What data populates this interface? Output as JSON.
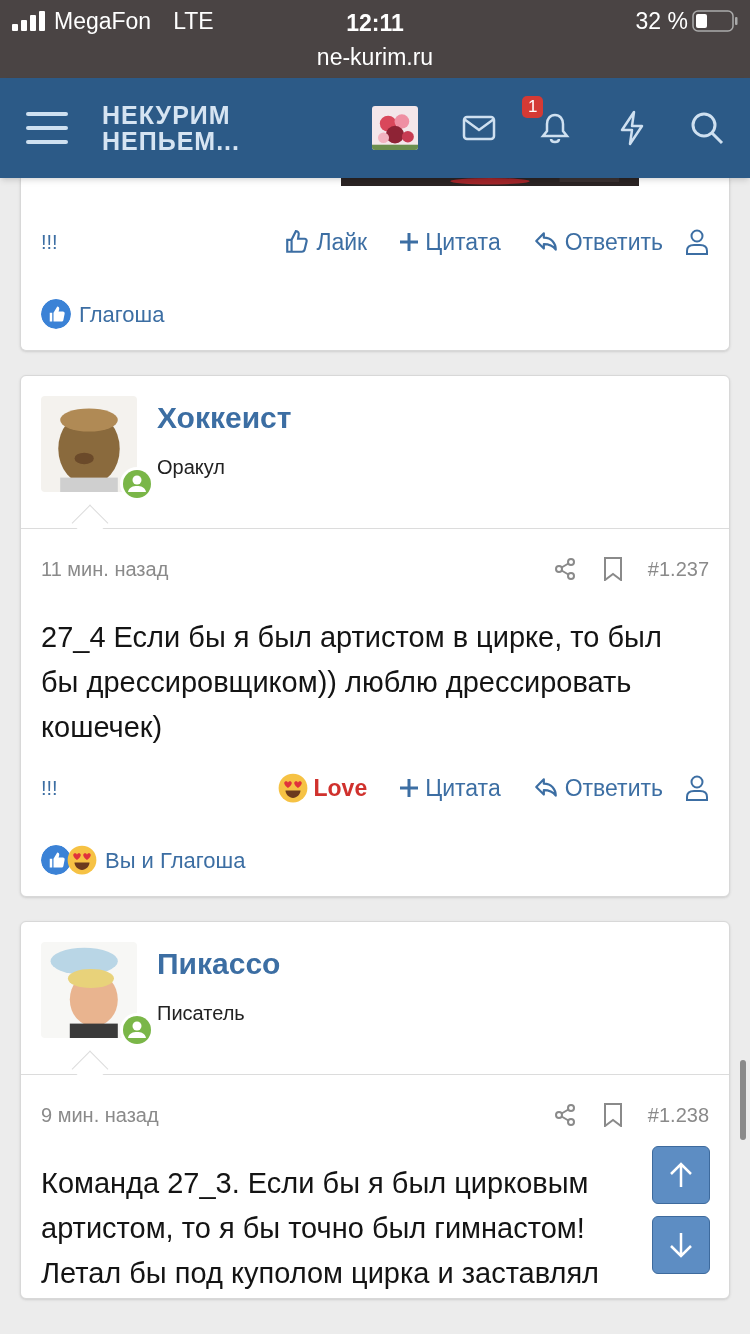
{
  "status_bar": {
    "carrier": "MegaFon",
    "network": "LTE",
    "time": "12:11",
    "url": "ne-kurim.ru",
    "battery": "32 %"
  },
  "header": {
    "logo_line1": "НЕКУРИМ",
    "logo_line2": "НЕПЬЕМ...",
    "notification_count": "1"
  },
  "posts": [
    {
      "flag": "!!!",
      "reaction_button": {
        "kind": "like",
        "label": "Лайк"
      },
      "quote": "Цитата",
      "reply": "Ответить",
      "reactions": {
        "icons": [
          {
            "kind": "like"
          }
        ],
        "text": "Глагоша"
      }
    },
    {
      "author": "Хоккеист",
      "role": "Оракул",
      "online": true,
      "time": "11 мин. назад",
      "number": "#1.237",
      "body": [
        "27_4 Если бы я был артистом в цирке, то был бы дрессировщиком)) люблю дрессировать кошечек)"
      ],
      "flag": "!!!",
      "reaction_button": {
        "kind": "love",
        "label": "Love"
      },
      "quote": "Цитата",
      "reply": "Ответить",
      "reactions": {
        "icons": [
          {
            "kind": "like"
          },
          {
            "kind": "love"
          }
        ],
        "text": "Вы и Глагоша"
      }
    },
    {
      "author": "Пикассо",
      "role": "Писатель",
      "online": true,
      "time": "9 мин. назад",
      "number": "#1.238",
      "body": [
        "Команда 27_3. Если бы я был цирковым артистом, то я бы точно был гимнастом! Летал бы под куполом цирка и заставлял"
      ]
    }
  ]
}
